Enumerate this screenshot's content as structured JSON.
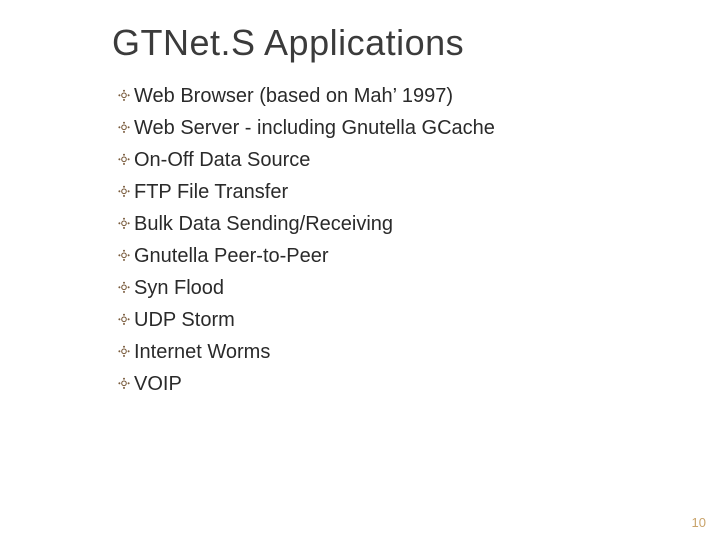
{
  "title": "GTNet.S Applications",
  "items": [
    "Web Browser (based on Mah’ 1997)",
    "Web Server - including Gnutella GCache",
    "On-Off Data Source",
    "FTP File Transfer",
    "Bulk Data Sending/Receiving",
    "Gnutella Peer-to-Peer",
    "Syn Flood",
    "UDP Storm",
    "Internet  Worms",
    "VOIP"
  ],
  "bullet_char": "༓",
  "page_number": "10"
}
